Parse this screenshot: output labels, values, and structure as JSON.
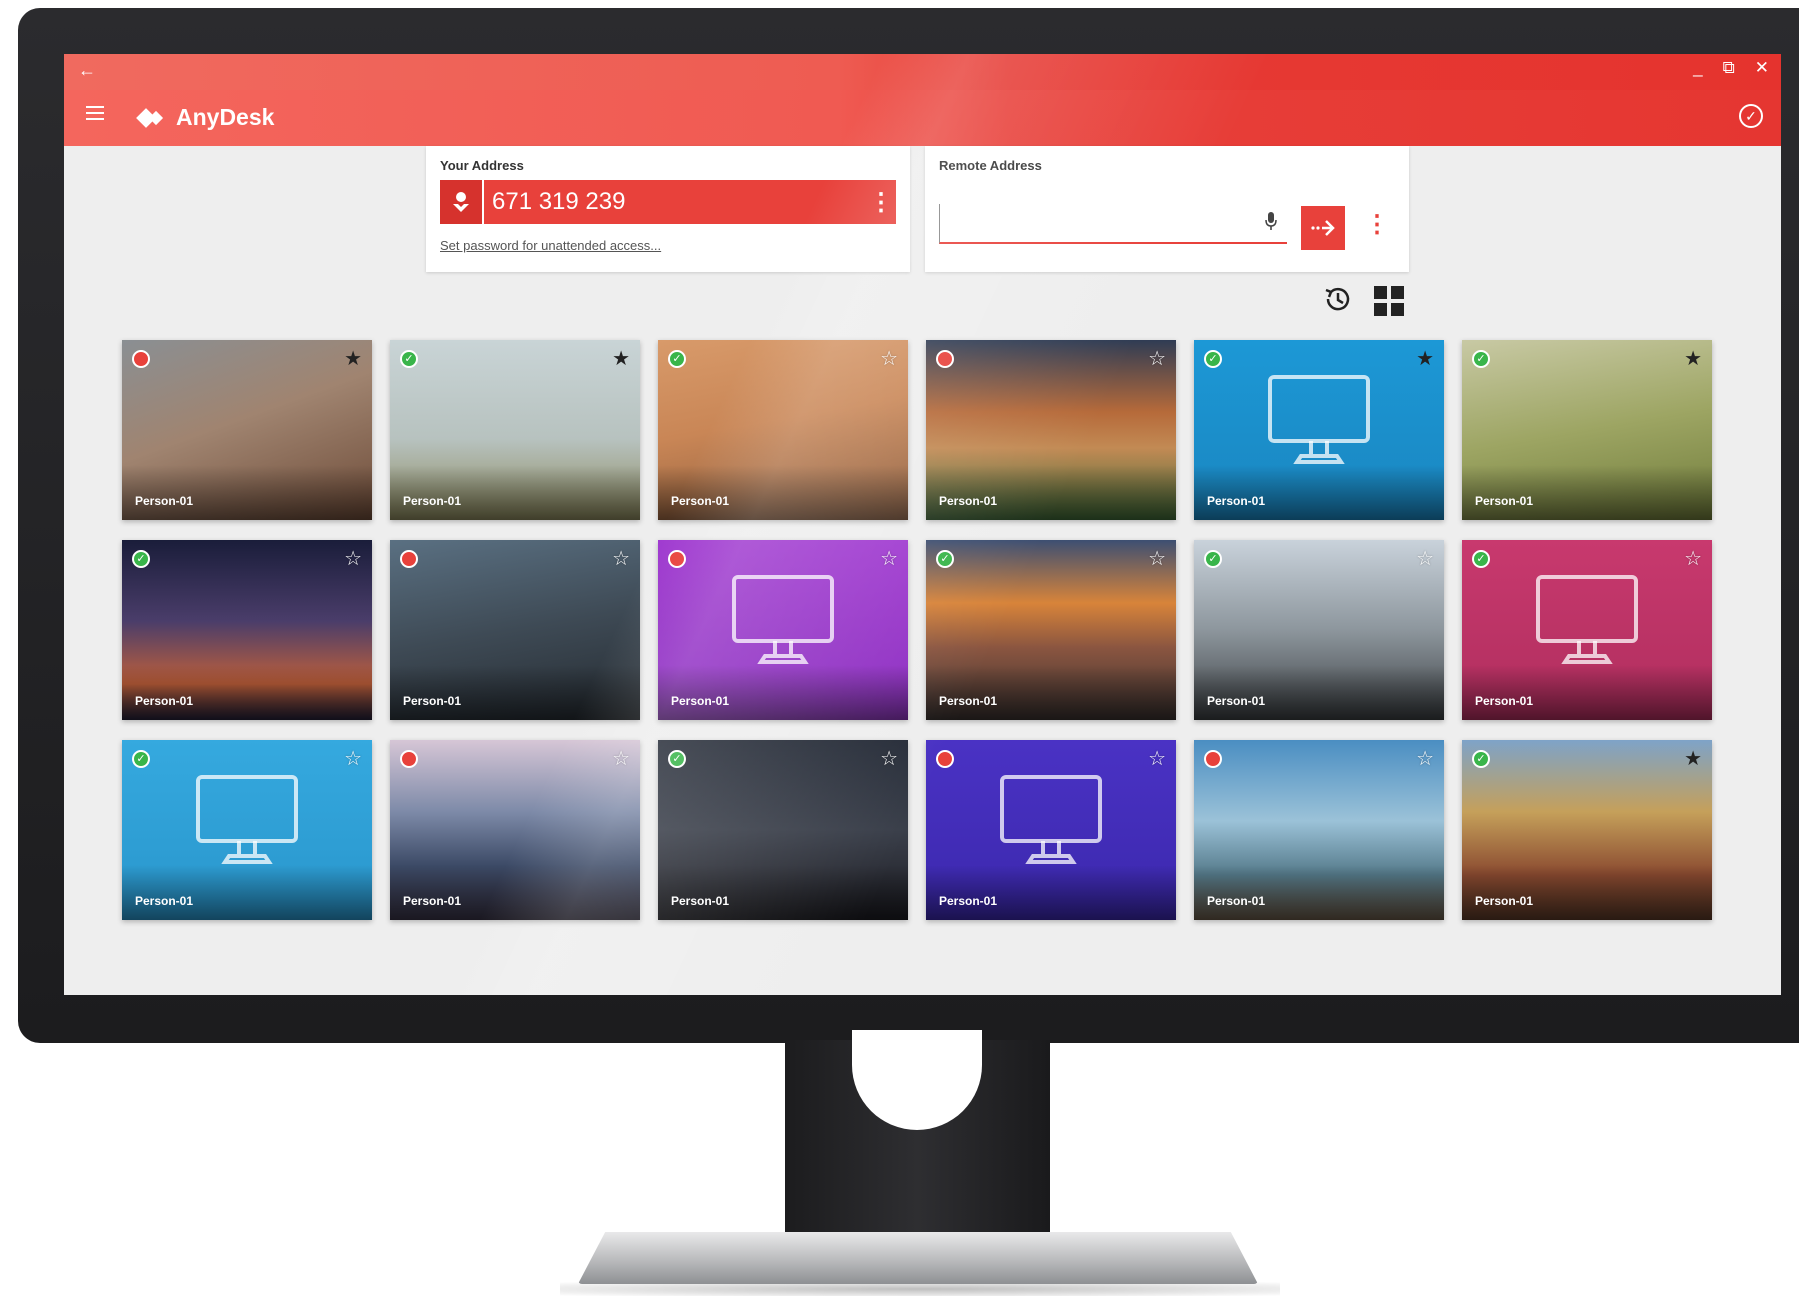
{
  "app": {
    "title": "AnyDesk",
    "brand_color": "#e8413b"
  },
  "titlebar": {
    "back_glyph": "←",
    "minimize_glyph": "_",
    "restore_glyph": "⧉",
    "close_glyph": "✕"
  },
  "your_address": {
    "label": "Your Address",
    "value": "671 319 239",
    "set_password_link": "Set password for unattended access..."
  },
  "remote_address": {
    "label": "Remote Address",
    "value": "",
    "placeholder": ""
  },
  "icons": {
    "menu": "hamburger-icon",
    "status": "check-circle-icon",
    "user": "user-download-icon",
    "more": "more-vertical-icon",
    "mic": "microphone-icon",
    "connect": "connect-arrow-icon",
    "history": "history-icon",
    "grid": "grid-view-icon"
  },
  "tiles": [
    {
      "name": "Person-01",
      "status": "offline",
      "starred": true,
      "bg": "canyon"
    },
    {
      "name": "Person-01",
      "status": "online",
      "starred": true,
      "bg": "bench"
    },
    {
      "name": "Person-01",
      "status": "online",
      "starred": false,
      "bg": "desert"
    },
    {
      "name": "Person-01",
      "status": "offline",
      "starred": false,
      "bg": "mountain"
    },
    {
      "name": "Person-01",
      "status": "online",
      "starred": true,
      "bg": "blue-monitor"
    },
    {
      "name": "Person-01",
      "status": "online",
      "starred": true,
      "bg": "meadow"
    },
    {
      "name": "Person-01",
      "status": "online",
      "starred": false,
      "bg": "night-city"
    },
    {
      "name": "Person-01",
      "status": "offline",
      "starred": false,
      "bg": "city-aerial"
    },
    {
      "name": "Person-01",
      "status": "offline",
      "starred": false,
      "bg": "purple-monitor"
    },
    {
      "name": "Person-01",
      "status": "online",
      "starred": false,
      "bg": "sunset-city"
    },
    {
      "name": "Person-01",
      "status": "online",
      "starred": false,
      "bg": "skyscrapers"
    },
    {
      "name": "Person-01",
      "status": "online",
      "starred": false,
      "bg": "pink-monitor"
    },
    {
      "name": "Person-01",
      "status": "online",
      "starred": false,
      "bg": "sky-monitor"
    },
    {
      "name": "Person-01",
      "status": "offline",
      "starred": false,
      "bg": "singapore"
    },
    {
      "name": "Person-01",
      "status": "online",
      "starred": false,
      "bg": "towers"
    },
    {
      "name": "Person-01",
      "status": "offline",
      "starred": false,
      "bg": "indigo-monitor"
    },
    {
      "name": "Person-01",
      "status": "offline",
      "starred": false,
      "bg": "hiker"
    },
    {
      "name": "Person-01",
      "status": "online",
      "starred": true,
      "bg": "village"
    }
  ],
  "tile_backgrounds": {
    "canyon": "linear-gradient(160deg,#8a8f93 0%,#a08470 45%,#6d4b38 100%)",
    "bench": "linear-gradient(180deg,#c9d4d6 0%,#b7c2bf 55%,#8d8a5e 100%)",
    "desert": "linear-gradient(170deg,#d89a6a 0%,#c98656 45%,#8a5a3a 100%)",
    "mountain": "linear-gradient(180deg,#2f3c54 0%,#b66a3a 40%,#c28a54 60%,#3f6a38 100%)",
    "blue-monitor": "linear-gradient(180deg,#1c98d6 0%,#1a86c0 100%)",
    "meadow": "linear-gradient(170deg,#c8c9a4 0%,#9da563 50%,#6f7b3a 100%)",
    "night-city": "linear-gradient(180deg,#1a1d3a 0%,#4a3d6a 45%,#c0603a 80%,#24213a 100%)",
    "city-aerial": "linear-gradient(170deg,#5a7082 0%,#3e4a55 50%,#242a30 100%)",
    "purple-monitor": "linear-gradient(180deg,#a03ad0 0%,#8a2bbf 100%)",
    "sunset-city": "linear-gradient(180deg,#3d4f72 0%,#d8843a 35%,#8a5540 60%,#3a3230 100%)",
    "skyscrapers": "linear-gradient(180deg,#c9d2db 0%,#8d969d 50%,#3b3f42 100%)",
    "pink-monitor": "linear-gradient(180deg,#c8396e 0%,#b02e5e 100%)",
    "sky-monitor": "linear-gradient(180deg,#35a9df 0%,#2996cc 100%)",
    "singapore": "linear-gradient(180deg,#d6c6d6 0%,#7d8aa8 40%,#3c4a66 70%,#3a3548 100%)",
    "towers": "linear-gradient(180deg,#262c38 0%,#3a3f4a 50%,#1c1c22 100%)",
    "indigo-monitor": "linear-gradient(180deg,#4a32c4 0%,#3b28ad 100%)",
    "hiker": "linear-gradient(180deg,#4a8ec2 0%,#9bc2d8 45%,#557a8a 75%,#6a5a48 100%)",
    "village": "linear-gradient(180deg,#7ea3c8 0%,#c5a05a 40%,#8a4a30 75%,#5c3a28 100%)"
  },
  "monitor_tiles": [
    "blue-monitor",
    "purple-monitor",
    "pink-monitor",
    "sky-monitor",
    "indigo-monitor"
  ]
}
